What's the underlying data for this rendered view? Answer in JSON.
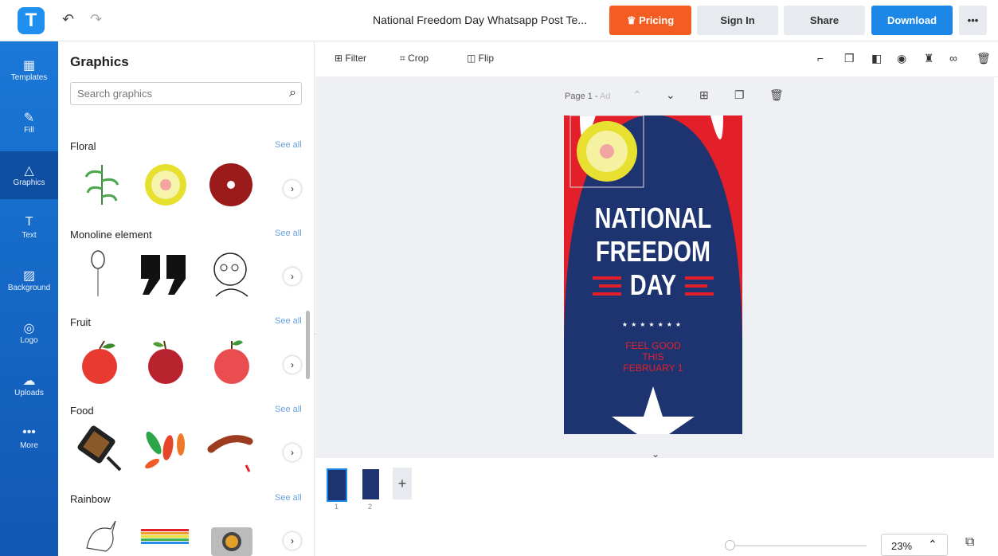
{
  "header": {
    "logo_letter": "T",
    "doc_title": "National Freedom Day Whatsapp Post Te...",
    "pricing": "Pricing",
    "sign_in": "Sign In",
    "share": "Share",
    "download": "Download",
    "more": "•••"
  },
  "nav": [
    {
      "label": "Templates"
    },
    {
      "label": "Fill"
    },
    {
      "label": "Graphics"
    },
    {
      "label": "Text"
    },
    {
      "label": "Background"
    },
    {
      "label": "Logo"
    },
    {
      "label": "Uploads"
    },
    {
      "label": "More"
    }
  ],
  "panel": {
    "title": "Graphics",
    "search_placeholder": "Search graphics",
    "see_all": "See all",
    "sections": [
      "Floral",
      "Monoline element",
      "Fruit",
      "Food",
      "Rainbow"
    ]
  },
  "toolbar": {
    "filter": "Filter",
    "crop": "Crop",
    "flip": "Flip"
  },
  "canvas": {
    "page_label": "Page 1 -",
    "page_suffix": "Ad"
  },
  "design": {
    "line1": "NATIONAL",
    "line2": "FREEDOM",
    "line3": "DAY",
    "sub1": "FEEL GOOD",
    "sub2": "THIS",
    "sub3": "FEBRUARY 1",
    "colors": {
      "navy": "#1e3470",
      "red": "#e3202a",
      "white": "#ffffff",
      "petal": "#e8e030"
    }
  },
  "pages": {
    "thumb1": "1",
    "thumb2": "2",
    "add": "+"
  },
  "zoom": {
    "value": "23%"
  }
}
